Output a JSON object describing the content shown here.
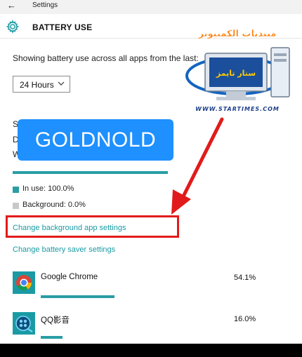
{
  "window": {
    "back_glyph": "←",
    "title": "Settings"
  },
  "header": {
    "icon": "gear-icon",
    "title": "BATTERY USE"
  },
  "main": {
    "description": "Showing battery use across all apps from the last:",
    "dropdown": {
      "selected": "24 Hours"
    },
    "partial_letters": [
      "S",
      "D",
      "W"
    ],
    "usage_fill_fraction": 1.0,
    "legend": {
      "in_use": "In use: 100.0%",
      "background": "Background: 0.0%"
    },
    "links": {
      "background_settings": "Change background app settings",
      "saver_settings": "Change battery saver settings"
    },
    "apps": [
      {
        "name": "Google Chrome",
        "percent": "54.1%",
        "fraction": 0.541,
        "icon": "chrome-icon"
      },
      {
        "name": "QQ影音",
        "percent": "16.0%",
        "fraction": 0.16,
        "icon": "qq-player-icon"
      }
    ]
  },
  "overlay": {
    "label": "GOLDNOLD"
  },
  "watermark": {
    "arabic_text": "منتديات الكمبيوتر",
    "badge_text": "ستار تايمز",
    "url": "WWW.STARTIMES.COM"
  },
  "colors": {
    "accent": "#2a9da5",
    "link": "#1a9ba4",
    "overlay_bg": "#1e90ff",
    "annotation_red": "#e11b1b",
    "background_legend": "#c8c8c8"
  }
}
